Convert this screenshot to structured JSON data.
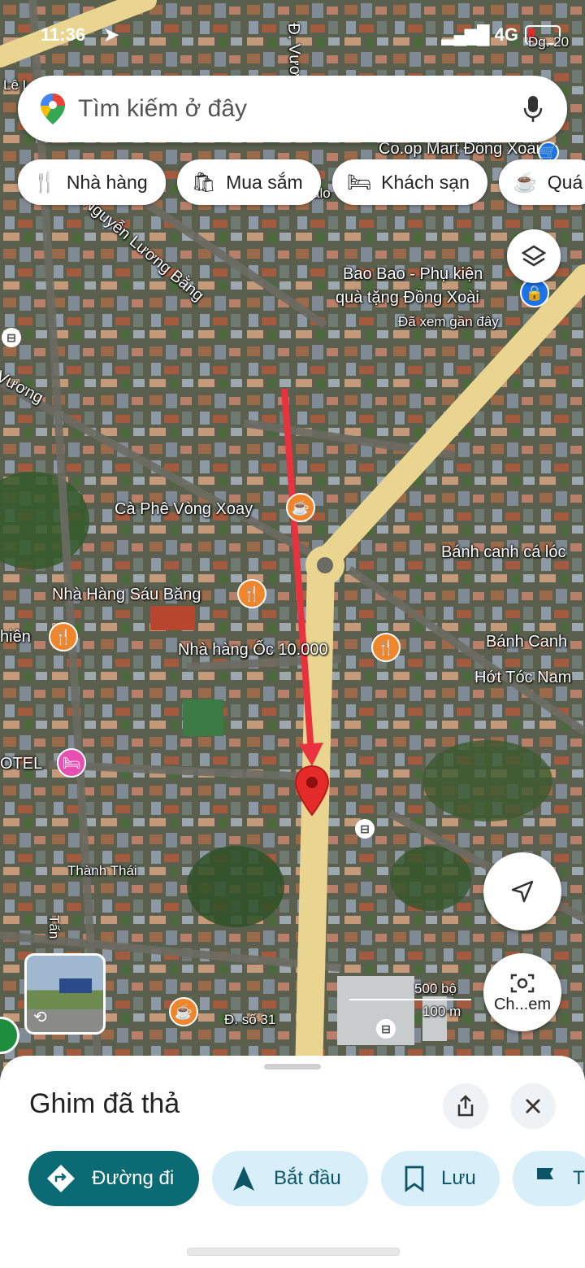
{
  "status": {
    "time": "11:36",
    "network": "4G"
  },
  "search": {
    "placeholder": "Tìm kiếm ở đây"
  },
  "chips": [
    {
      "label": "Nhà hàng",
      "icon": "fork-knife-icon"
    },
    {
      "label": "Mua sắm",
      "icon": "shopping-bag-icon"
    },
    {
      "label": "Khách sạn",
      "icon": "bed-icon"
    },
    {
      "label": "Quá",
      "icon": "cafe-cup-icon"
    }
  ],
  "map": {
    "streets": {
      "vuong_top": "Đ. Vương",
      "le": "Lê L",
      "luong_bang": "Nguyễn Lương Bằng",
      "vuong_left": "Vương",
      "thanh_thai": "Thành Thái",
      "tan": "Tấn",
      "so31": "Đ. số 31",
      "tg20": "Đg. 20",
      "alo": "alo"
    },
    "places": {
      "coopmart": "Co.op Mart Đồng Xoài",
      "baobao": "Bao Bao - Phụ kiện",
      "baobao2": "quà tặng Đồng Xoài",
      "baobao_seen": "Đã xem gần đây",
      "caphe": "Cà Phê Vòng Xoay",
      "banhcanh1": "Bánh canh cá lóc",
      "nhahang_sau": "Nhà Hàng Sáu Băng",
      "thien": "hiên",
      "nhahang_oc": "Nhà hàng Ốc 10.000",
      "banhcanh2": "Bánh Canh",
      "hottoc": "Hớt Tóc Nam",
      "otel": "OTEL"
    },
    "scale": {
      "feet": "500 bộ",
      "meters": "100 m"
    },
    "lens_label": "Ch...em"
  },
  "sheet": {
    "title": "Ghim đã thả",
    "actions": [
      {
        "label": "Đường đi",
        "icon": "directions-icon"
      },
      {
        "label": "Bắt đầu",
        "icon": "navigation-arrow-icon"
      },
      {
        "label": "Lưu",
        "icon": "bookmark-icon"
      },
      {
        "label": "T",
        "icon": "flag-icon"
      }
    ]
  },
  "colors": {
    "accent": "#0b6b74",
    "pin": "#e52a2a",
    "arrow": "#e8333f",
    "road": "#e9d58f"
  }
}
